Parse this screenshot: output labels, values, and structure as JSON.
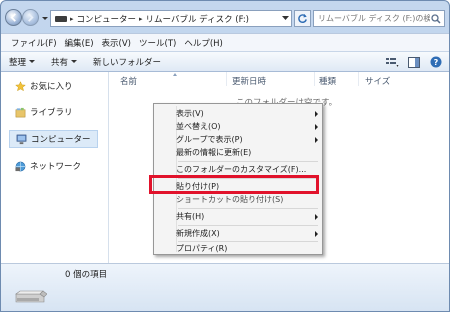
{
  "address_bar": {
    "breadcrumbs": [
      "コンピューター",
      "リムーバブル ディスク (F:)"
    ]
  },
  "search": {
    "placeholder": "リムーバブル ディスク (F:)の検索"
  },
  "menubar": {
    "items": [
      "ファイル(F)",
      "編集(E)",
      "表示(V)",
      "ツール(T)",
      "ヘルプ(H)"
    ]
  },
  "toolbar": {
    "organize": "整理",
    "share": "共有",
    "new_folder": "新しいフォルダー"
  },
  "nav_pane": {
    "items": [
      "お気に入り",
      "ライブラリ",
      "コンピューター",
      "ネットワーク"
    ],
    "selected": "コンピューター"
  },
  "columns": [
    "名前",
    "更新日時",
    "種類",
    "サイズ"
  ],
  "empty_message": "このフォルダーは空です。",
  "status": {
    "item_count": "0 個の項目"
  },
  "context_menu": {
    "items": [
      {
        "label": "表示(V)",
        "submenu": true
      },
      {
        "label": "並べ替え(O)",
        "submenu": true
      },
      {
        "label": "グループで表示(P)",
        "submenu": true
      },
      {
        "label": "最新の情報に更新(E)",
        "submenu": false
      },
      {
        "label": "このフォルダーのカスタマイズ(F)...",
        "submenu": false
      },
      {
        "label": "貼り付け(P)",
        "submenu": false
      },
      {
        "label": "ショートカットの貼り付け(S)",
        "submenu": false
      },
      {
        "label": "共有(H)",
        "submenu": true
      },
      {
        "label": "新規作成(X)",
        "submenu": true
      },
      {
        "label": "プロパティ(R)",
        "submenu": false
      }
    ],
    "highlighted": "貼り付け(P)"
  },
  "colors": {
    "highlight_border": "#e1122b",
    "selected_nav": "#dceaf8"
  }
}
